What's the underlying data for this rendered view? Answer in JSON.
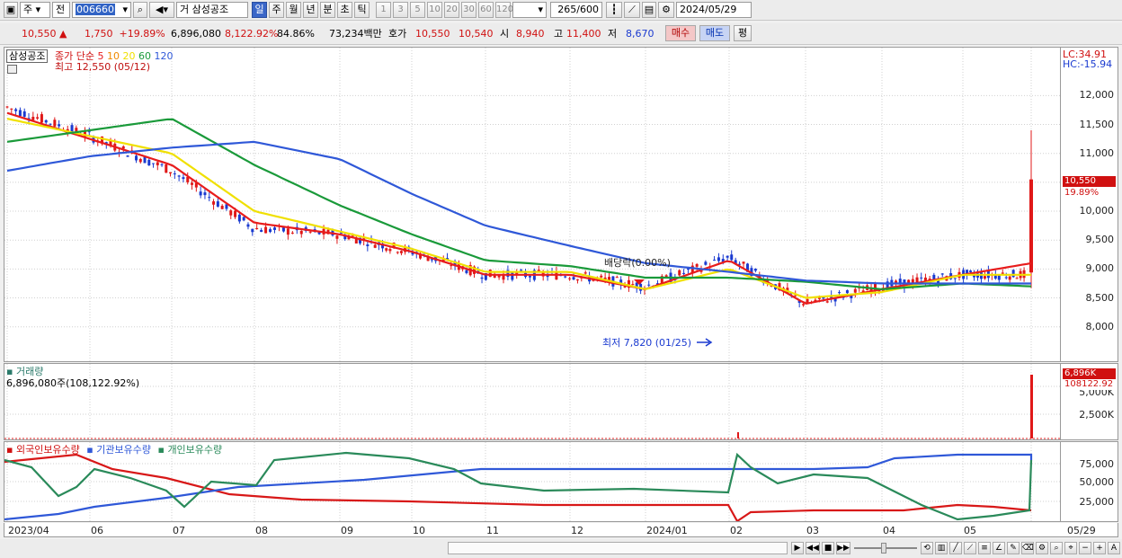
{
  "toolbar1": {
    "market": "주",
    "prefix": "전",
    "code": "006660",
    "type_prefix": "거",
    "name": "삼성공조",
    "periods": [
      "일",
      "주",
      "월",
      "년",
      "분",
      "초",
      "틱"
    ],
    "active_period": "일",
    "intervals": [
      "1",
      "3",
      "5",
      "10",
      "20",
      "30",
      "60",
      "120"
    ],
    "count": "265",
    "max": "/600",
    "date": "2024/05/29"
  },
  "toolbar2": {
    "price": "10,550",
    "arrow": "▲",
    "change": "1,750",
    "rate": "+19.89%",
    "volume": "6,896,080",
    "vol_rate": "8,122.92%",
    "vol_pct": "84.86%",
    "amount": "73,234백만",
    "quote_label": "호가",
    "ask": "10,550",
    "bid": "10,540",
    "open_label": "시",
    "open": "8,940",
    "high_label": "고",
    "high": "11,400",
    "low_label": "저",
    "low": "8,670",
    "buy": "매수",
    "sell": "매도",
    "avg": "평"
  },
  "price_panel": {
    "legend_name": "삼성공조",
    "legend_ma": "종가 단순",
    "ma_periods": [
      "5",
      "10",
      "20",
      "60",
      "120"
    ],
    "ma_colors": [
      "#e81c1c",
      "#f08a00",
      "#f0e000",
      "#1a9a3a",
      "#2f58d8"
    ],
    "high_note": "최고 12,550 (05/12)",
    "low_note": "최저 7,820 (01/25)",
    "dividend_note": "배당락(0.00%)",
    "lc": "LC:34.91",
    "hc": "HC:-15.94",
    "price_tag": "10,550",
    "rate_tag": "19.89%",
    "y_ticks": [
      "12,000",
      "11,500",
      "11,000",
      "10,500",
      "10,000",
      "9,500",
      "9,000",
      "8,500",
      "8,000"
    ]
  },
  "volume_panel": {
    "title": "거래량",
    "value": "6,896,080주(108,122.92%)",
    "tag1": "6,896K",
    "tag2": "108122.92",
    "y_ticks": [
      "5,000K",
      "2,500K"
    ]
  },
  "holding_panel": {
    "legend": [
      "외국인보유수량",
      "기관보유수량",
      "개인보유수량"
    ],
    "colors": [
      "#d81818",
      "#2f58d8",
      "#2a8a5a"
    ],
    "y_ticks": [
      "75,000",
      "50,000",
      "25,000"
    ]
  },
  "x_axis": [
    "2023/04",
    "06",
    "07",
    "08",
    "09",
    "10",
    "11",
    "12",
    "2024/01",
    "02",
    "03",
    "04",
    "05",
    "05/29"
  ],
  "chart_data": {
    "type": "line",
    "title": "삼성공조",
    "x": [
      "2023/04",
      "06",
      "07",
      "08",
      "09",
      "10",
      "11",
      "12",
      "2024/01",
      "02",
      "03",
      "04",
      "05",
      "05/29"
    ],
    "ylim": [
      7700,
      12550
    ],
    "series": [
      {
        "name": "종가",
        "values": [
          11800,
          11300,
          10700,
          9700,
          9600,
          9300,
          8900,
          8900,
          8700,
          9200,
          8400,
          8700,
          8900,
          10550
        ]
      },
      {
        "name": "5",
        "values": [
          11700,
          11250,
          10800,
          9800,
          9600,
          9300,
          8900,
          8900,
          8650,
          9150,
          8400,
          8650,
          8900,
          9100
        ]
      },
      {
        "name": "20",
        "values": [
          11600,
          11300,
          11000,
          10000,
          9650,
          9350,
          8950,
          8950,
          8650,
          9000,
          8500,
          8600,
          8900,
          8900
        ]
      },
      {
        "name": "60",
        "values": [
          11200,
          11400,
          11600,
          10800,
          10100,
          9600,
          9150,
          9050,
          8850,
          8850,
          8780,
          8650,
          8750,
          8700
        ]
      },
      {
        "name": "120",
        "values": [
          10700,
          10950,
          11100,
          11200,
          10900,
          10300,
          9750,
          9400,
          9100,
          8950,
          8800,
          8750,
          8750,
          8750
        ]
      }
    ]
  }
}
